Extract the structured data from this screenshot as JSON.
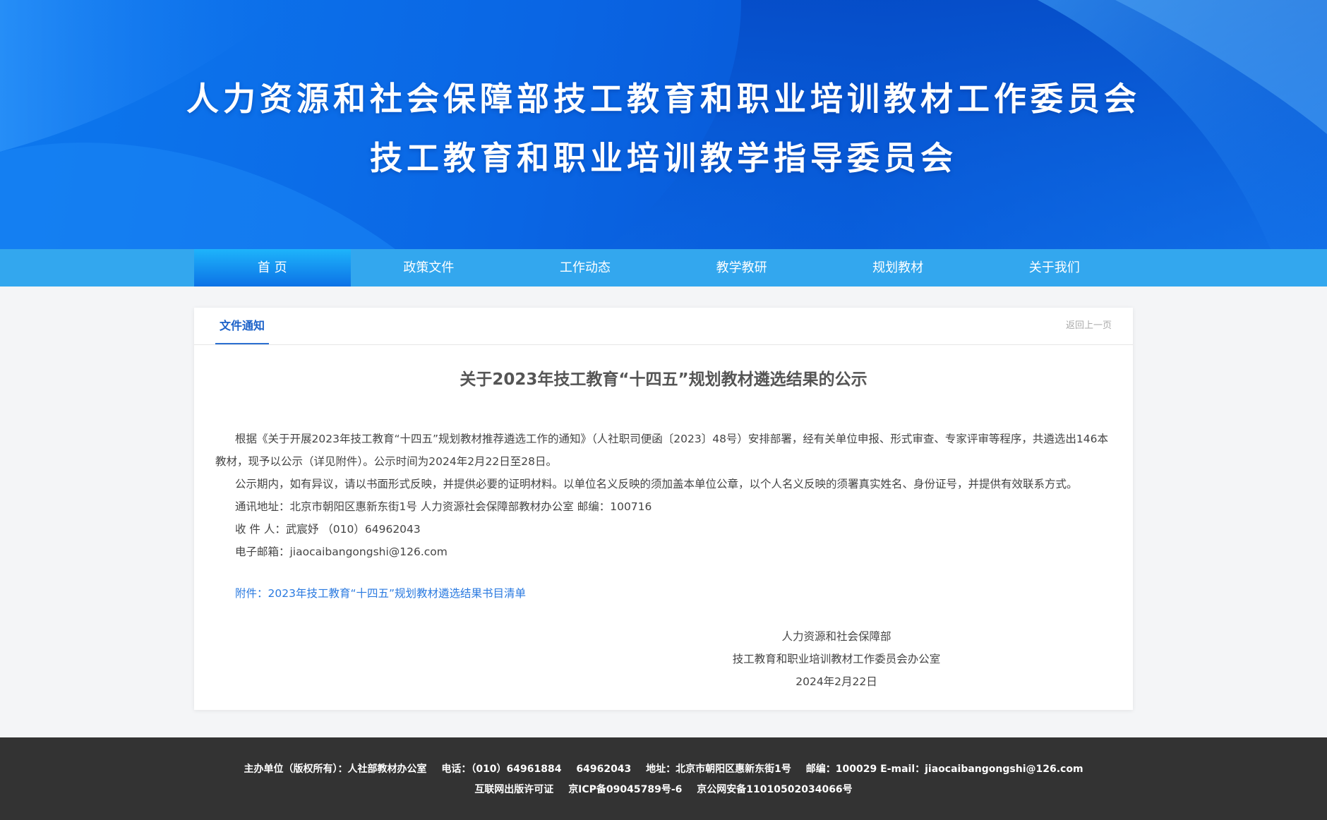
{
  "banner": {
    "title_line1": "人力资源和社会保障部技工教育和职业培训教材工作委员会",
    "title_line2": "技工教育和职业培训教学指导委员会"
  },
  "nav": {
    "items": [
      {
        "label": "首 页",
        "active": true
      },
      {
        "label": "政策文件",
        "active": false
      },
      {
        "label": "工作动态",
        "active": false
      },
      {
        "label": "教学教研",
        "active": false
      },
      {
        "label": "规划教材",
        "active": false
      },
      {
        "label": "关于我们",
        "active": false
      }
    ]
  },
  "card": {
    "tab_label": "文件通知",
    "back_label": "返回上一页",
    "title": "关于2023年技工教育“十四五”规划教材遴选结果的公示",
    "paragraphs": [
      "根据《关于开展2023年技工教育“十四五”规划教材推荐遴选工作的通知》（人社职司便函〔2023〕48号）安排部署，经有关单位申报、形式审查、专家评审等程序，共遴选出146本教材，现予以公示（详见附件）。公示时间为2024年2月22日至28日。",
      "公示期内，如有异议，请以书面形式反映，并提供必要的证明材料。以单位名义反映的须加盖本单位公章，以个人名义反映的须署真实姓名、身份证号，并提供有效联系方式。",
      "通讯地址：北京市朝阳区惠新东街1号 人力资源社会保障部教材办公室  邮编：100716",
      "收 件 人：武宸妤 （010）64962043",
      "电子邮箱：jiaocaibangongshi@126.com"
    ],
    "attachment": "附件：2023年技工教育“十四五”规划教材遴选结果书目清单",
    "signature": {
      "org1": "人力资源和社会保障部",
      "org2": "技工教育和职业培训教材工作委员会办公室",
      "date": "2024年2月22日"
    }
  },
  "footer": {
    "host": "主办单位（版权所有）：人社部教材办公室",
    "phone": "电话：（010）64961884",
    "phone2": "64962043",
    "address": "地址：北京市朝阳区惠新东街1号",
    "postcode_email": "邮编：100029 E-mail：jiaocaibangongshi@126.com",
    "license": "互联网出版许可证",
    "icp": "京ICP备09045789号-6",
    "security": "京公网安备11010502034066号"
  },
  "colors": {
    "banner_blue": "#0a66e4",
    "nav_blue": "#33a7ee",
    "accent": "#1c62c9",
    "link": "#2a7ae0",
    "footer_bg": "#333333"
  }
}
